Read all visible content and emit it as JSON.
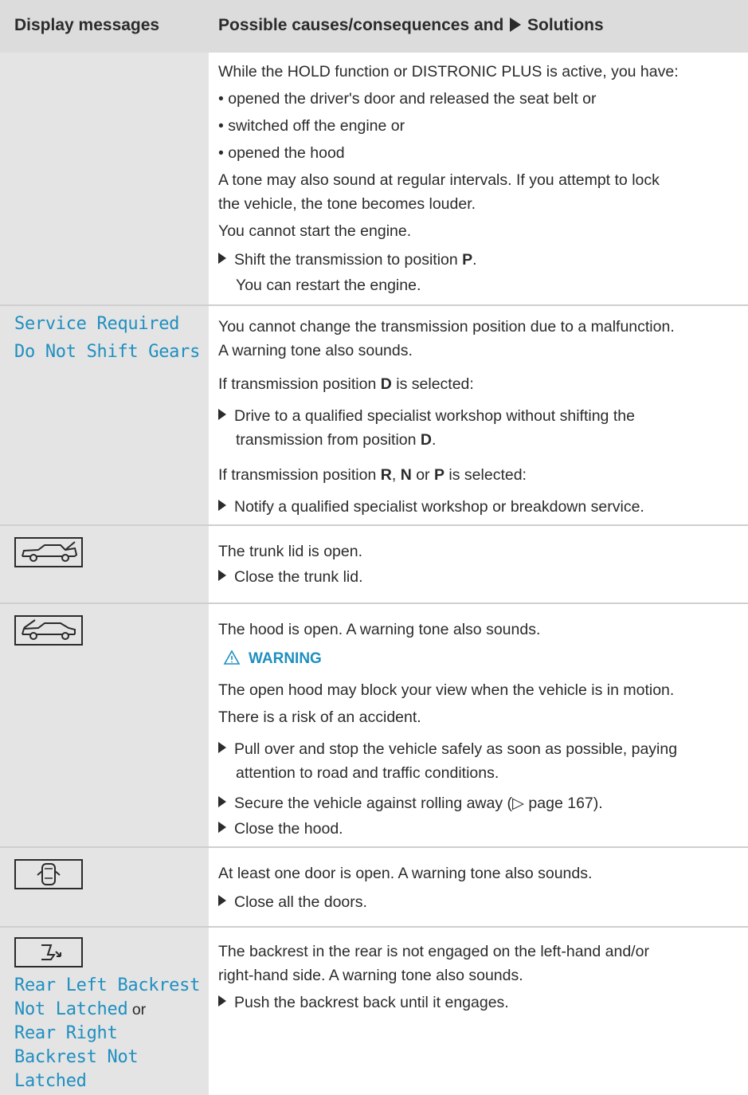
{
  "header": {
    "col1": "Display messages",
    "col2a": "Possible causes/consequences and",
    "col2b": "Solutions"
  },
  "row1": {
    "intro": "While the HOLD function or DISTRONIC PLUS is active, you have:",
    "b1": "• opened the driver's door and released the seat belt or",
    "b2": "• switched off the engine or",
    "b3": "• opened the hood",
    "tone1": "A tone may also sound at regular intervals. If you attempt to lock",
    "tone2": "the vehicle, the tone becomes louder.",
    "cannot": "You cannot start the engine.",
    "step1a": "Shift the transmission to position ",
    "step1b": "P",
    "step1c": ".",
    "step2": "You can restart the engine."
  },
  "row2": {
    "msg1": "Service Required",
    "msg2": "Do Not Shift Gears",
    "l1": "You cannot change the transmission position due to a malfunction.",
    "l2": "A warning tone also sounds.",
    "l3a": "If transmission position ",
    "l3b": "D",
    "l3c": " is selected:",
    "s1": "Drive to a qualified specialist workshop without shifting the",
    "s1b": "transmission from position ",
    "s1c": "D",
    "s1d": ".",
    "l4a": "If transmission position ",
    "l4b": "R",
    "l4c": ", ",
    "l4d": "N",
    "l4e": " or ",
    "l4f": "P",
    "l4g": " is selected:",
    "s2": "Notify a qualified specialist workshop or breakdown service."
  },
  "row3": {
    "icon": "trunk-open-icon",
    "l1": "The trunk lid is open.",
    "s1": "Close the trunk lid."
  },
  "row4": {
    "icon": "hood-open-icon",
    "l1": "The hood is open. A warning tone also sounds.",
    "warn": "WARNING",
    "w1": "The open hood may block your view when the vehicle is in motion.",
    "w2": "There is a risk of an accident.",
    "s1": "Pull over and stop the vehicle safely as soon as possible, paying",
    "s1b": "attention to road and traffic conditions.",
    "s2": "Secure the vehicle against rolling away (▷ page 167).",
    "s3": "Close the hood."
  },
  "row5": {
    "icon": "door-open-icon",
    "l1": "At least one door is open. A warning tone also sounds.",
    "s1": "Close all the doors."
  },
  "row6": {
    "icon": "backrest-icon",
    "m1": "Rear Left Backrest",
    "m2": "Not Latched",
    "or": " or",
    "m3": "Rear Right",
    "m4": "Backrest Not",
    "m5": "Latched",
    "l1": "The backrest in the rear is not engaged on the left-hand and/or",
    "l2": "right-hand side. A warning tone also sounds.",
    "s1": "Push the backrest back until it engages."
  }
}
